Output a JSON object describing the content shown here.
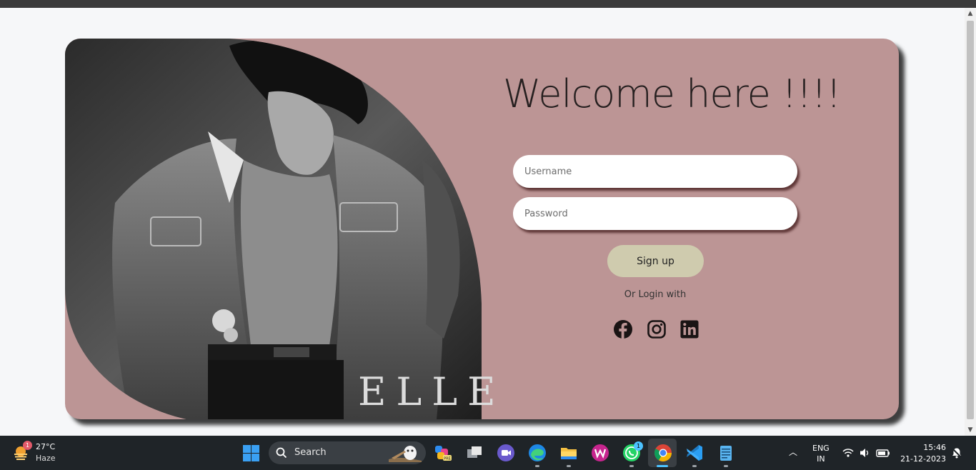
{
  "page": {
    "title": "Welcome here !!!!",
    "username_placeholder": "Username",
    "password_placeholder": "Password",
    "signup_label": "Sign up",
    "or_login_label": "Or Login with",
    "photo_watermark": "ELLE",
    "social": [
      "facebook-icon",
      "instagram-icon",
      "linkedin-icon"
    ],
    "colors": {
      "card": "#bc9595",
      "button": "#cfcbae",
      "text": "#262020"
    }
  },
  "taskbar": {
    "weather": {
      "badge": "1",
      "temp": "27°C",
      "condition": "Haze"
    },
    "search_label": "Search",
    "whatsapp_badge": "1",
    "apps": [
      "copilot-icon",
      "task-view-icon",
      "meet-icon",
      "edge-icon",
      "file-explorer-icon",
      "wps-icon",
      "whatsapp-icon",
      "chrome-icon",
      "vscode-icon",
      "notepad-icon"
    ],
    "lang_top": "ENG",
    "lang_bottom": "IN",
    "time": "15:46",
    "date": "21-12-2023"
  }
}
